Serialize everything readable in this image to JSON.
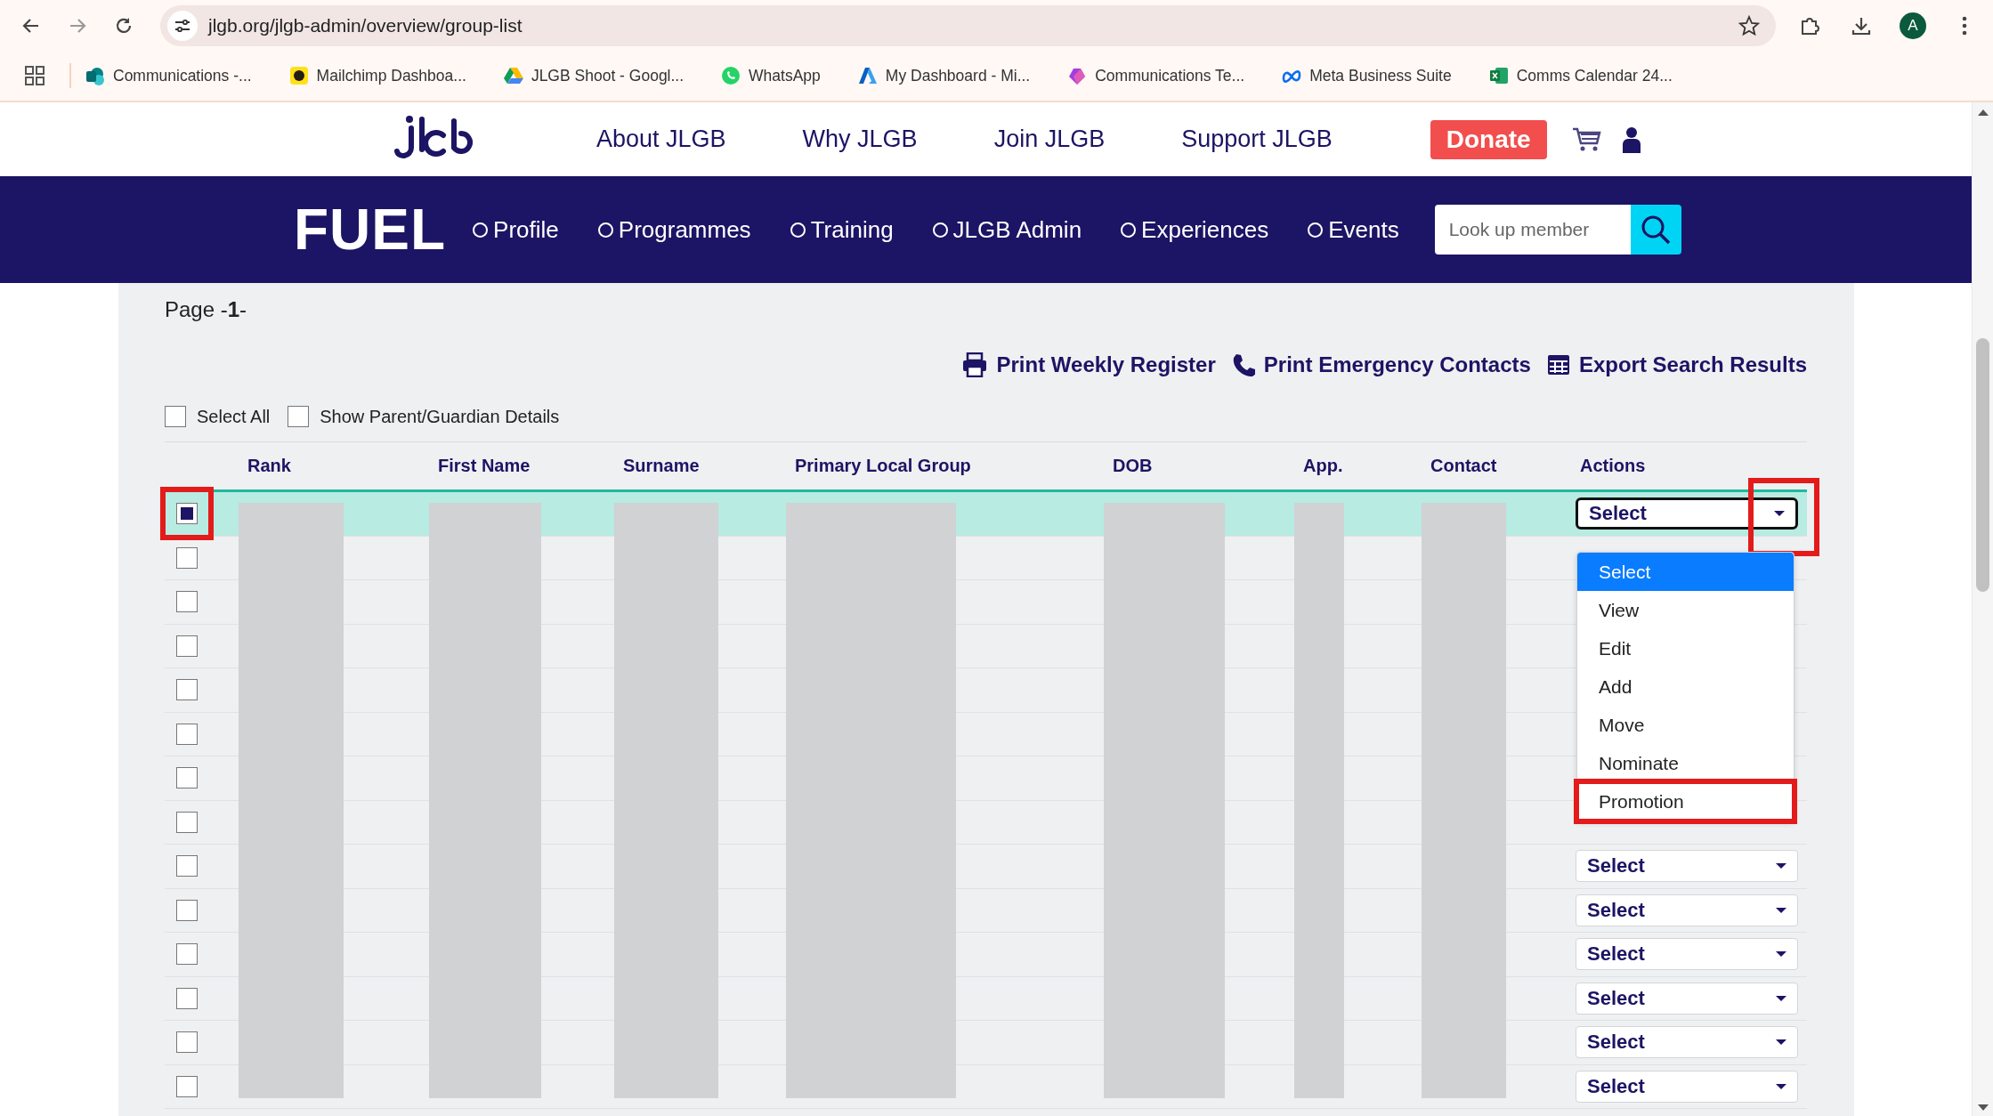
{
  "browser": {
    "url": "jlgb.org/jlgb-admin/overview/group-list",
    "avatar": "A",
    "bookmarks": [
      {
        "kind": "sharepoint",
        "label": "Communications -..."
      },
      {
        "kind": "mailchimp",
        "label": "Mailchimp Dashboa..."
      },
      {
        "kind": "drive",
        "label": "JLGB Shoot - Googl..."
      },
      {
        "kind": "whatsapp",
        "label": "WhatsApp"
      },
      {
        "kind": "azure",
        "label": "My Dashboard - Mi..."
      },
      {
        "kind": "loop",
        "label": "Communications Te..."
      },
      {
        "kind": "meta",
        "label": "Meta Business Suite"
      },
      {
        "kind": "excel",
        "label": "Comms Calendar 24..."
      }
    ]
  },
  "site_header": {
    "nav": [
      "About JLGB",
      "Why JLGB",
      "Join JLGB",
      "Support JLGB"
    ],
    "donate": "Donate"
  },
  "fuel_bar": {
    "title": "FUEL",
    "nav": [
      "Profile",
      "Programmes",
      "Training",
      "JLGB Admin",
      "Experiences",
      "Events"
    ],
    "search": {
      "placeholder": "Look up member"
    }
  },
  "page_label": "Page -**1**-",
  "actions": [
    {
      "kind": "printer",
      "label": "Print Weekly Register"
    },
    {
      "kind": "phone",
      "label": "Print Emergency Contacts"
    },
    {
      "kind": "table",
      "label": "Export Search Results"
    }
  ],
  "options": [
    {
      "label": "Select All",
      "checked": false
    },
    {
      "label": "Show Parent/Guardian Details",
      "checked": false
    }
  ],
  "table": {
    "columns": [
      {
        "label": "Rank",
        "kind": "redacted"
      },
      {
        "label": "First Name",
        "kind": "redacted"
      },
      {
        "label": "Surname",
        "kind": "redacted"
      },
      {
        "label": "Primary Local Group",
        "kind": "redacted"
      },
      {
        "label": "DOB",
        "kind": "redacted"
      },
      {
        "label": "App.",
        "kind": "redacted"
      },
      {
        "label": "Contact",
        "kind": "redacted"
      },
      {
        "label": "Actions",
        "kind": "actions"
      }
    ],
    "rows": [
      {
        "selected": true,
        "checked": true,
        "select": "Select",
        "focused": true,
        "checkbox_annotated": true,
        "arrow_annotated": true
      },
      {
        "selected": false,
        "checked": false
      },
      {
        "selected": false,
        "checked": false
      },
      {
        "selected": false,
        "checked": false
      },
      {
        "selected": false,
        "checked": false
      },
      {
        "selected": false,
        "checked": false
      },
      {
        "selected": false,
        "checked": false
      },
      {
        "selected": false,
        "checked": false
      },
      {
        "selected": false,
        "checked": false,
        "select": "Select",
        "focused": false
      },
      {
        "selected": false,
        "checked": false,
        "select": "Select",
        "focused": false
      },
      {
        "selected": false,
        "checked": false,
        "select": "Select",
        "focused": false
      },
      {
        "selected": false,
        "checked": false,
        "select": "Select",
        "focused": false
      },
      {
        "selected": false,
        "checked": false,
        "select": "Select",
        "focused": false
      },
      {
        "selected": false,
        "checked": false,
        "select": "Select",
        "focused": false
      }
    ]
  },
  "dropdown": {
    "options": [
      {
        "label": "Select",
        "selected": true,
        "annotated": false
      },
      {
        "label": "View",
        "selected": false,
        "annotated": false
      },
      {
        "label": "Edit",
        "selected": false,
        "annotated": false
      },
      {
        "label": "Add",
        "selected": false,
        "annotated": false
      },
      {
        "label": "Move",
        "selected": false,
        "annotated": false
      },
      {
        "label": "Nominate",
        "selected": false,
        "annotated": false
      },
      {
        "label": "Promotion",
        "selected": false,
        "annotated": true
      }
    ]
  }
}
